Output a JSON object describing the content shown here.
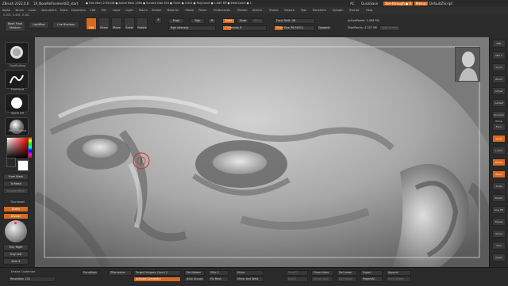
{
  "titlebar": {
    "app": "ZBrush 2022.0.6",
    "doc": "19_NoseRefinement02_start",
    "stats": "● Free Mem 2.951GB ● Active Mem 2564 ● Scratch Disk 816 ● Timer ● 0.001 ● PolyCount ● 1.085 MP ● MeshCount ● 1",
    "ac": "AC",
    "quicksave": "QuickSave",
    "seethrough": "See-through ● 0",
    "menus_label": "Menus",
    "default_script": "DefaultZScript"
  },
  "menu": [
    "Alpha",
    "Brush",
    "Color",
    "Document",
    "Draw",
    "Dynamics",
    "Edit",
    "File",
    "Layer",
    "Light",
    "Macro",
    "Marker",
    "Material",
    "Movie",
    "Picker",
    "Preferences",
    "Render",
    "Stencil",
    "Stroke",
    "Texture",
    "Tool",
    "Transform",
    "Zplugin",
    "Zscript",
    "Help"
  ],
  "coords": "0.005, 0.458, 0.162",
  "shelf": {
    "boolean_master": "Boolt Food Mastcer",
    "lightbox": "LightBox",
    "live_boolean": "Live Boolean",
    "edit": "Edit",
    "draw": "Draw",
    "move": "Move",
    "scale": "Scale",
    "rotate": "Rotate",
    "mrgb": "Mrgb",
    "rgb": "Rgb",
    "m": "M",
    "rgb_intensity": "Rgb Intensity",
    "zadd": "Zadd",
    "zsub": "Zsub",
    "zcut": "Zcut",
    "z_intensity": "Z Intensity 8",
    "focal_shift": "Focal Shift -36",
    "draw_size": "Draw Size 36.93311",
    "dynamic": "Dynamic",
    "active_points": "ActivePoints: 1.085 Mil",
    "total_points": "TotalPoints: 4.337 Mil",
    "split_screen": "Split Screen"
  },
  "left": {
    "brush_label": "ClayBuildup",
    "stroke_label": "FreeHand",
    "alpha_label": "Alpha Off",
    "material_label": "BasicMaterial",
    "from_mesh": "From Mesh",
    "to_mesh": "To Mesh",
    "double_mesh": "Double Mesh",
    "thumbnail": "Thumbnail",
    "gizmo": "Gizmo",
    "dyna": "Divider",
    "tray_right": "Tray Right",
    "tray_left": "Tray Left",
    "zero_x": "Zero X"
  },
  "right": [
    "BPR",
    "SPix 3",
    "Scroll",
    "Zoom",
    "Actual",
    "AAHalf",
    "Dynamic Persp",
    "Floor",
    "Local",
    "L.Sym",
    "Frame",
    "Move",
    "Scale",
    "Rotate",
    "Line Fill",
    "Transp",
    "Ghost",
    "Solo",
    "Xpose"
  ],
  "bottom": {
    "enable_customize": "Enable Customize",
    "resolution": "Resolution 128",
    "dynamesh": "DynaMesh",
    "zremesher": "ZRemesher",
    "target_polygons": "Target Polygons Count 5",
    "activate_symmetry": "Activate Symmetry",
    "del_hidden": "Del Hidden",
    "auto_groups": "Auto Groups",
    "sdiv": "SDiv 5",
    "fix_mesh": "Fix Mesh",
    "mirror": "Mirror",
    "mirror_and_weld": "Mirror And Weld",
    "scroll_to": "ScrollT",
    "dellh": "DelLH",
    "close_holes": "Close Holes",
    "absolute_split": "Absolt Split",
    "del_lower": "Del Lower",
    "del_higher": "Del Higher",
    "export": "Export",
    "project_all": "ProjectAll",
    "append": "Append",
    "split_hidden": "Split Hidden"
  },
  "colors": {
    "accent": "#d86a20",
    "panel": "#2a2a2a",
    "viewport": "#8c8c8c"
  }
}
